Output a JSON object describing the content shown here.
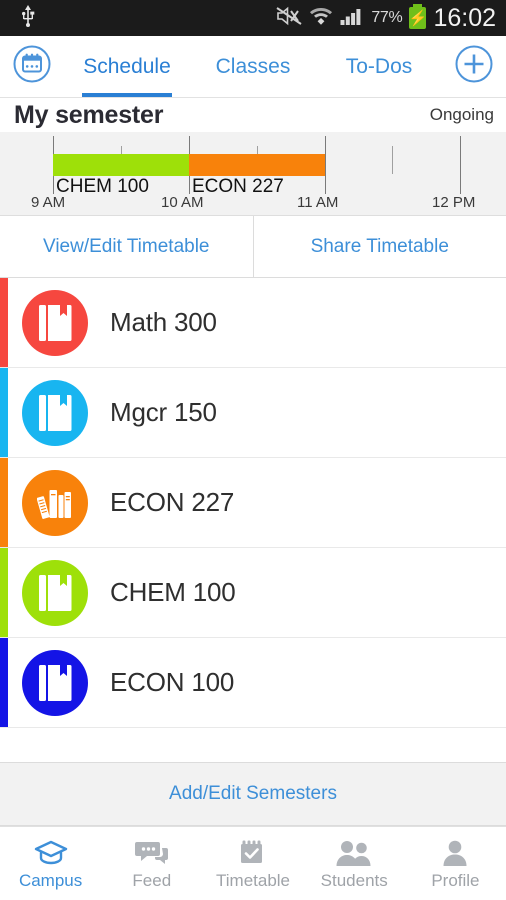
{
  "status_bar": {
    "usb_icon": "usb-icon",
    "mute_icon": "volume-muted-icon",
    "wifi_icon": "wifi-icon",
    "signal_icon": "cellular-signal-icon",
    "battery_percent": "77%",
    "battery_icon": "battery-charging-icon",
    "clock": "16:02"
  },
  "header": {
    "calendar_icon": "calendar-icon",
    "add_icon": "plus-icon",
    "tabs": [
      {
        "label": "Schedule",
        "active": true
      },
      {
        "label": "Classes",
        "active": false
      },
      {
        "label": "To-Dos",
        "active": false
      }
    ],
    "accent_color": "#3d8fd8"
  },
  "semester": {
    "title": "My semester",
    "status": "Ongoing"
  },
  "timeline": {
    "axis_labels": [
      "9 AM",
      "10 AM",
      "11 AM",
      "12 PM"
    ],
    "events": [
      {
        "label": "CHEM 100",
        "color": "#9ee009",
        "start": "9 AM",
        "end": "10 AM"
      },
      {
        "label": "ECON 227",
        "color": "#f8820b",
        "start": "10 AM",
        "end": "11 AM"
      }
    ]
  },
  "actions": {
    "view_edit": "View/Edit Timetable",
    "share": "Share Timetable"
  },
  "courses": [
    {
      "name": "Math 300",
      "color": "#f6473f",
      "icon": "book-icon"
    },
    {
      "name": "Mgcr 150",
      "color": "#18b5f0",
      "icon": "book-icon"
    },
    {
      "name": "ECON 227",
      "color": "#f8820b",
      "icon": "books-stack-icon"
    },
    {
      "name": "CHEM 100",
      "color": "#9ee009",
      "icon": "book-icon"
    },
    {
      "name": "ECON 100",
      "color": "#1414e6",
      "icon": "book-icon"
    }
  ],
  "footer": {
    "add_edit_semesters": "Add/Edit Semesters"
  },
  "bottom_nav": [
    {
      "label": "Campus",
      "icon": "graduation-cap-icon",
      "active": true
    },
    {
      "label": "Feed",
      "icon": "chat-bubbles-icon",
      "active": false
    },
    {
      "label": "Timetable",
      "icon": "calendar-check-icon",
      "active": false
    },
    {
      "label": "Students",
      "icon": "people-icon",
      "active": false
    },
    {
      "label": "Profile",
      "icon": "person-icon",
      "active": false
    }
  ]
}
